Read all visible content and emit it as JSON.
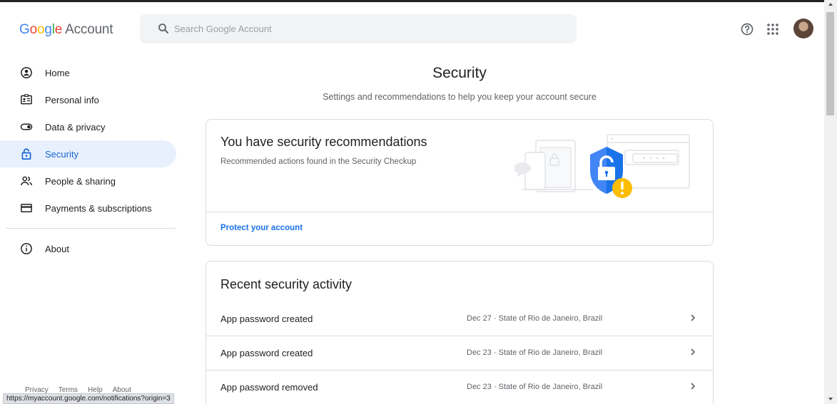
{
  "header": {
    "logo_google": [
      "G",
      "o",
      "o",
      "g",
      "l",
      "e"
    ],
    "logo_account": "Account",
    "search_placeholder": "Search Google Account",
    "icons": [
      "help-icon",
      "apps-grid-icon",
      "avatar"
    ]
  },
  "sidebar": {
    "items": [
      {
        "label": "Home",
        "icon": "home-icon"
      },
      {
        "label": "Personal info",
        "icon": "id-card-icon"
      },
      {
        "label": "Data & privacy",
        "icon": "toggle-icon"
      },
      {
        "label": "Security",
        "icon": "lock-icon",
        "active": true
      },
      {
        "label": "People & sharing",
        "icon": "people-icon"
      },
      {
        "label": "Payments & subscriptions",
        "icon": "card-icon"
      }
    ],
    "about": {
      "label": "About",
      "icon": "info-icon"
    },
    "footer": [
      "Privacy",
      "Terms",
      "Help",
      "About"
    ]
  },
  "status_url": "https://myaccount.google.com/notifications?origin=3",
  "main": {
    "title": "Security",
    "subtitle": "Settings and recommendations to help you keep your account secure",
    "recommend_card": {
      "title": "You have security recommendations",
      "subtitle": "Recommended actions found in the Security Checkup",
      "link": "Protect your account"
    },
    "activity_card": {
      "title": "Recent security activity",
      "rows": [
        {
          "name": "App password created",
          "meta": "Dec 27 · State of Rio de Janeiro, Brazil"
        },
        {
          "name": "App password created",
          "meta": "Dec 23 · State of Rio de Janeiro, Brazil"
        },
        {
          "name": "App password removed",
          "meta": "Dec 23 · State of Rio de Janeiro, Brazil"
        }
      ]
    }
  },
  "colors": {
    "accent": "#1a73e8",
    "active_bg": "#e8f0fe",
    "shield": "#4285f4",
    "warning": "#fbbc04"
  }
}
